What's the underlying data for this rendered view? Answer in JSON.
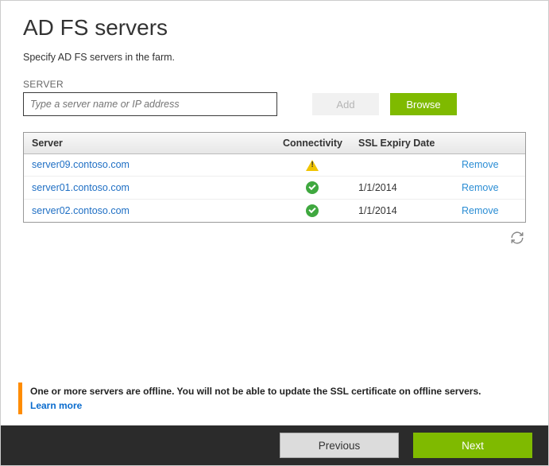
{
  "header": {
    "title": "AD FS servers",
    "subtitle": "Specify AD FS servers in the farm."
  },
  "serverField": {
    "label": "SERVER",
    "placeholder": "Type a server name or IP address"
  },
  "buttons": {
    "add": "Add",
    "browse": "Browse",
    "previous": "Previous",
    "next": "Next"
  },
  "table": {
    "headers": {
      "server": "Server",
      "connectivity": "Connectivity",
      "ssl": "SSL Expiry Date",
      "action": ""
    },
    "rows": [
      {
        "server": "server09.contoso.com",
        "status": "warn",
        "ssl": "",
        "action": "Remove"
      },
      {
        "server": "server01.contoso.com",
        "status": "ok",
        "ssl": "1/1/2014",
        "action": "Remove"
      },
      {
        "server": "server02.contoso.com",
        "status": "ok",
        "ssl": "1/1/2014",
        "action": "Remove"
      }
    ]
  },
  "alert": {
    "text": "One or more servers are offline. You will not be able to update the SSL certificate on offline servers.",
    "link": "Learn more"
  }
}
